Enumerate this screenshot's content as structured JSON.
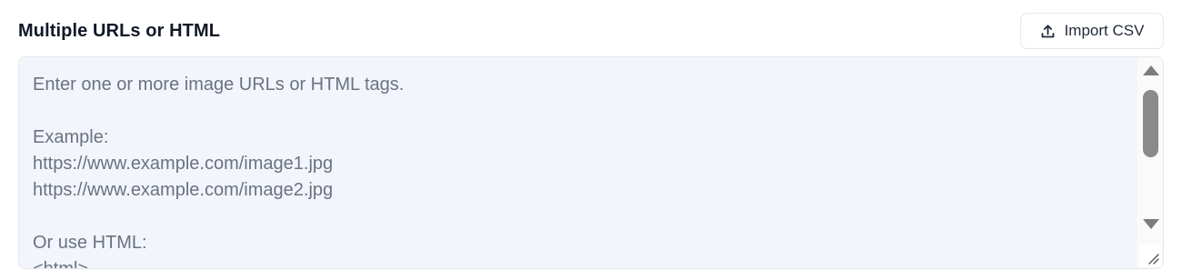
{
  "section": {
    "title": "Multiple URLs or HTML"
  },
  "toolbar": {
    "import_label": "Import CSV",
    "import_icon": "upload-icon"
  },
  "textarea": {
    "placeholder": "Enter one or more image URLs or HTML tags.\n\nExample:\nhttps://www.example.com/image1.jpg\nhttps://www.example.com/image2.jpg\n\nOr use HTML:\n<html>"
  },
  "colors": {
    "textarea_bg": "#f2f5fb",
    "placeholder_text": "#6b7280",
    "title_text": "#111827",
    "border": "#e5e7eb"
  }
}
